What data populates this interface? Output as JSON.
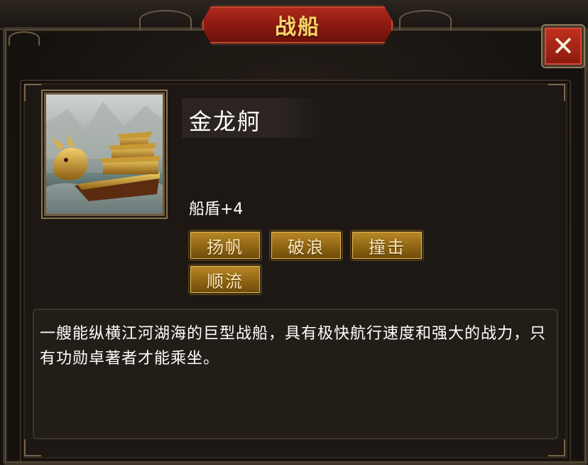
{
  "dialog": {
    "title": "战船",
    "close_label": "✕"
  },
  "ship": {
    "name": "金龙舸",
    "stat": "船盾+4",
    "skills": [
      "扬帆",
      "破浪",
      "撞击",
      "顺流"
    ],
    "description": "一艘能纵横江河湖海的巨型战船，具有极快航行速度和强大的战力，只有功勋卓著者才能乘坐。"
  },
  "colors": {
    "title_plaque": "#a3251a",
    "title_text": "#f7d56a",
    "skill_button": "#9c7018",
    "close_button": "#b22a1c"
  }
}
